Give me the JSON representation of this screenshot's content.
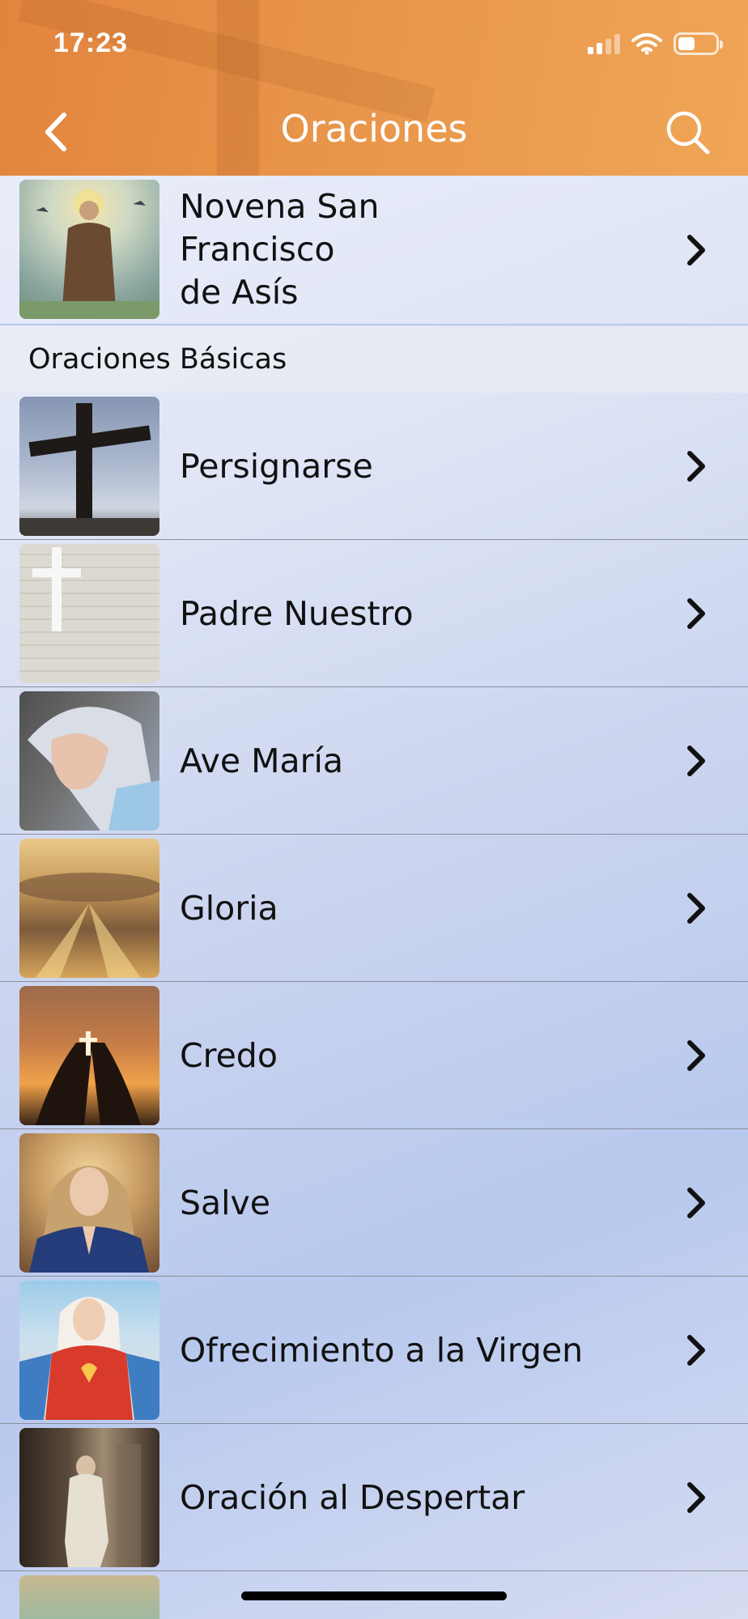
{
  "status_bar": {
    "time": "17:23",
    "battery_level": 0.45
  },
  "nav": {
    "title": "Oraciones"
  },
  "featured": {
    "label_line1": "Novena San Francisco",
    "label_line2": "de Asís",
    "thumb_icon": "saint-francis-image"
  },
  "section": {
    "label": "Oraciones Básicas"
  },
  "prayers": [
    {
      "label": "Persignarse",
      "thumb_icon": "cross-sky-image"
    },
    {
      "label": "Padre Nuestro",
      "thumb_icon": "white-cross-wall-image"
    },
    {
      "label": "Ave María",
      "thumb_icon": "virgin-mary-veil-image"
    },
    {
      "label": "Gloria",
      "thumb_icon": "sun-rays-clouds-image"
    },
    {
      "label": "Credo",
      "thumb_icon": "hands-holding-cross-image"
    },
    {
      "label": "Salve",
      "thumb_icon": "praying-virgin-image"
    },
    {
      "label": "Ofrecimiento a la Virgen",
      "thumb_icon": "sacred-heart-mary-image"
    },
    {
      "label": "Oración al Despertar",
      "thumb_icon": "kneeling-monk-image"
    }
  ],
  "colors": {
    "header_orange": "#e8954a",
    "text": "#111111",
    "chevron": "#111111"
  }
}
